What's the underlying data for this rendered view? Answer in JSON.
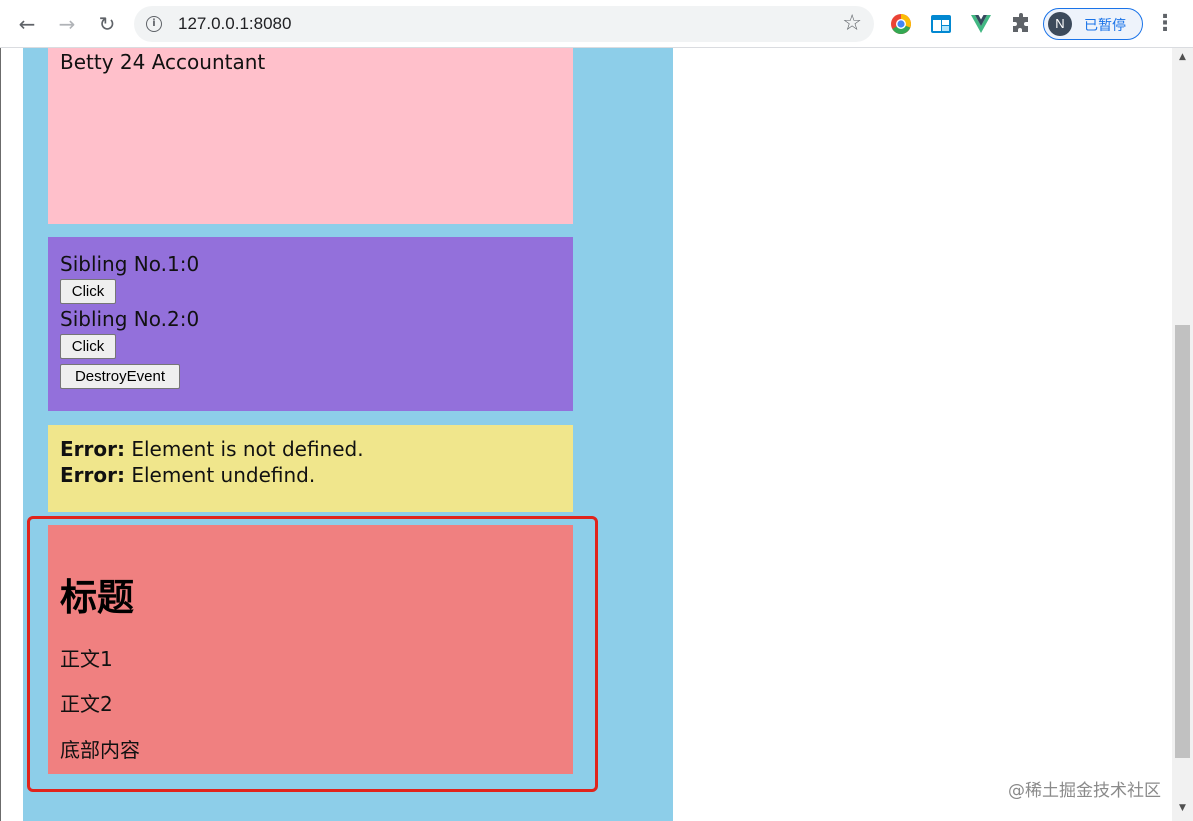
{
  "browser": {
    "url": "127.0.0.1:8080",
    "back_icon": "arrow-left",
    "forward_icon": "arrow-right",
    "reload_icon": "reload",
    "info_icon": "info",
    "bookmark_icon": "star",
    "extensions": [
      "chrome-extension",
      "mail-extension",
      "vue-devtools",
      "extensions-puzzle"
    ],
    "profile": {
      "initial": "N",
      "label": "已暂停"
    },
    "menu_icon": "more-vertical"
  },
  "page": {
    "person": {
      "text": "Betty 24 Accountant"
    },
    "siblings": {
      "sibling1_label": "Sibling No.1:0",
      "sibling1_button": "Click",
      "sibling2_label": "Sibling No.2:0",
      "sibling2_button": "Click",
      "destroy_button": "DestroyEvent"
    },
    "errors": {
      "line1_prefix": "Error:",
      "line1_text": " Element is not defined.",
      "line2_prefix": "Error:",
      "line2_text": " Element undefind."
    },
    "slot_card": {
      "title": "标题",
      "line1": "正文1",
      "line2": "正文2",
      "footer": "底部内容"
    }
  },
  "watermark": "@稀土掘金技术社区",
  "colors": {
    "container_bg": "#8dcee9",
    "person_bg": "#ffc0cb",
    "sibling_bg": "#9370db",
    "error_bg": "#f0e68c",
    "slot_bg": "#f08080",
    "highlight_border": "#e0241c"
  }
}
